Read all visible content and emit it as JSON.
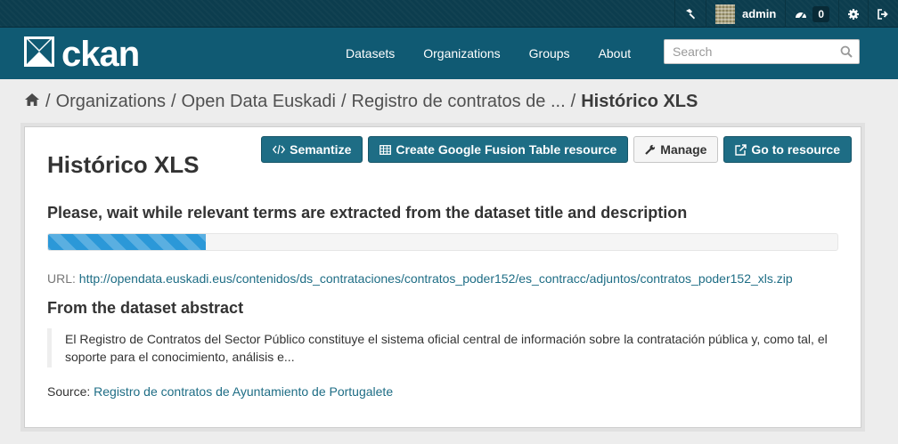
{
  "account": {
    "username": "admin",
    "notifications_count": "0"
  },
  "masthead": {
    "logo_text": "ckan",
    "nav": [
      {
        "label": "Datasets"
      },
      {
        "label": "Organizations"
      },
      {
        "label": "Groups"
      },
      {
        "label": "About"
      }
    ],
    "search_placeholder": "Search"
  },
  "breadcrumb": {
    "items": [
      "Organizations",
      "Open Data Euskadi",
      "Registro de contratos de ..."
    ],
    "active": "Histórico XLS"
  },
  "resource": {
    "title": "Histórico XLS",
    "actions": {
      "semantize": "Semantize",
      "fusion": "Create Google Fusion Table resource",
      "manage": "Manage",
      "go": "Go to resource"
    },
    "wait_message": "Please, wait while relevant terms are extracted from the dataset title and description",
    "progress_fraction": 0.2,
    "url_label": "URL:",
    "url": "http://opendata.euskadi.eus/contenidos/ds_contrataciones/contratos_poder152/es_contracc/adjuntos/contratos_poder152_xls.zip",
    "abstract_heading": "From the dataset abstract",
    "abstract_text": "El Registro de Contratos del Sector Público constituye el sistema oficial central de información sobre la contratación pública y, como tal, el soporte para el conocimiento, análisis e...",
    "source_label": "Source:",
    "source_link": "Registro de contratos de Ayuntamiento de Portugalete"
  },
  "colors": {
    "masthead": "#105a73",
    "account_bar": "#0c3d4e",
    "primary_button": "#1e6d85",
    "progress": "#2b98d8"
  },
  "icons": [
    "sysadmin-hammer-icon",
    "dashboard-icon",
    "gear-icon",
    "sign-out-icon",
    "search-icon",
    "home-icon",
    "code-icon",
    "table-icon",
    "wrench-icon",
    "external-link-icon"
  ]
}
